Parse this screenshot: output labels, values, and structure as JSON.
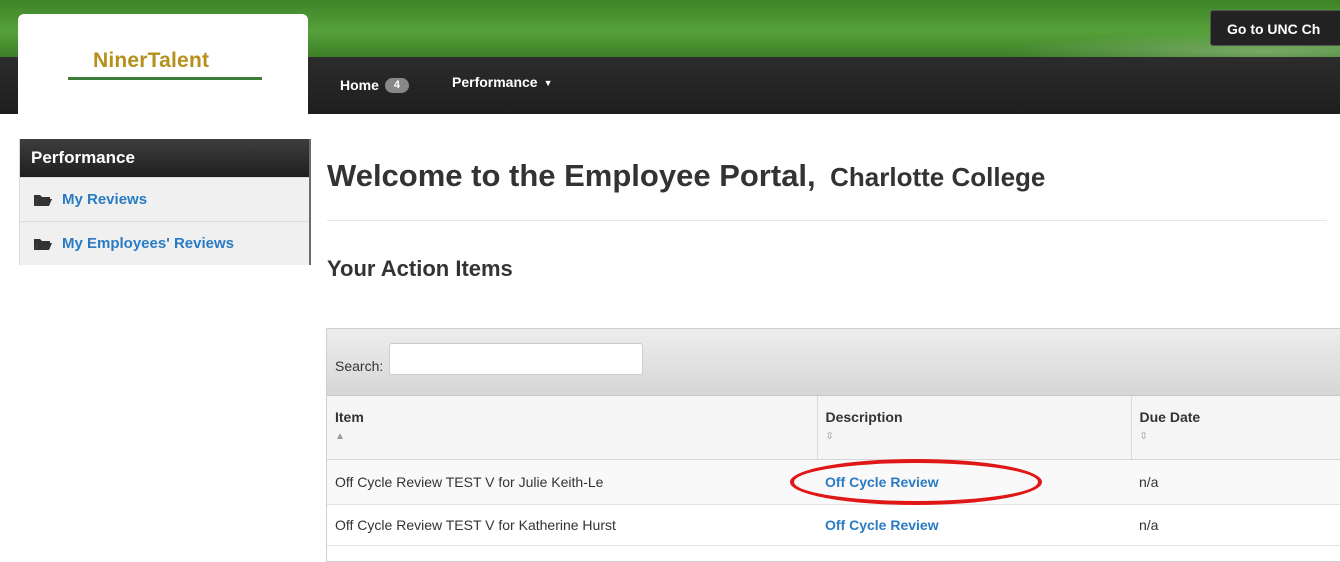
{
  "header": {
    "logo_text": "NinerTalent",
    "external_button": "Go to UNC Ch",
    "nav": {
      "home_label": "Home",
      "home_badge": "4",
      "performance_label": "Performance"
    }
  },
  "sidebar": {
    "title": "Performance",
    "items": [
      {
        "label": "My Reviews",
        "icon": "folder-open-icon"
      },
      {
        "label": "My Employees' Reviews",
        "icon": "folder-open-icon"
      }
    ]
  },
  "main": {
    "title": "Welcome to the Employee Portal,",
    "subtitle": "Charlotte College",
    "section_title": "Your Action Items",
    "search_label": "Search:",
    "table": {
      "columns": [
        "Item",
        "Description",
        "Due Date"
      ],
      "rows": [
        {
          "item": "Off Cycle Review TEST V for Julie Keith-Le",
          "description": "Off Cycle Review",
          "due": "n/a"
        },
        {
          "item": "Off Cycle Review TEST V for Katherine Hurst",
          "description": "Off Cycle Review",
          "due": "n/a"
        }
      ]
    }
  },
  "colors": {
    "brand_green": "#4a9530",
    "link_blue": "#2a7bc4",
    "logo_gold": "#b5901a",
    "highlight_red": "#e01717"
  }
}
